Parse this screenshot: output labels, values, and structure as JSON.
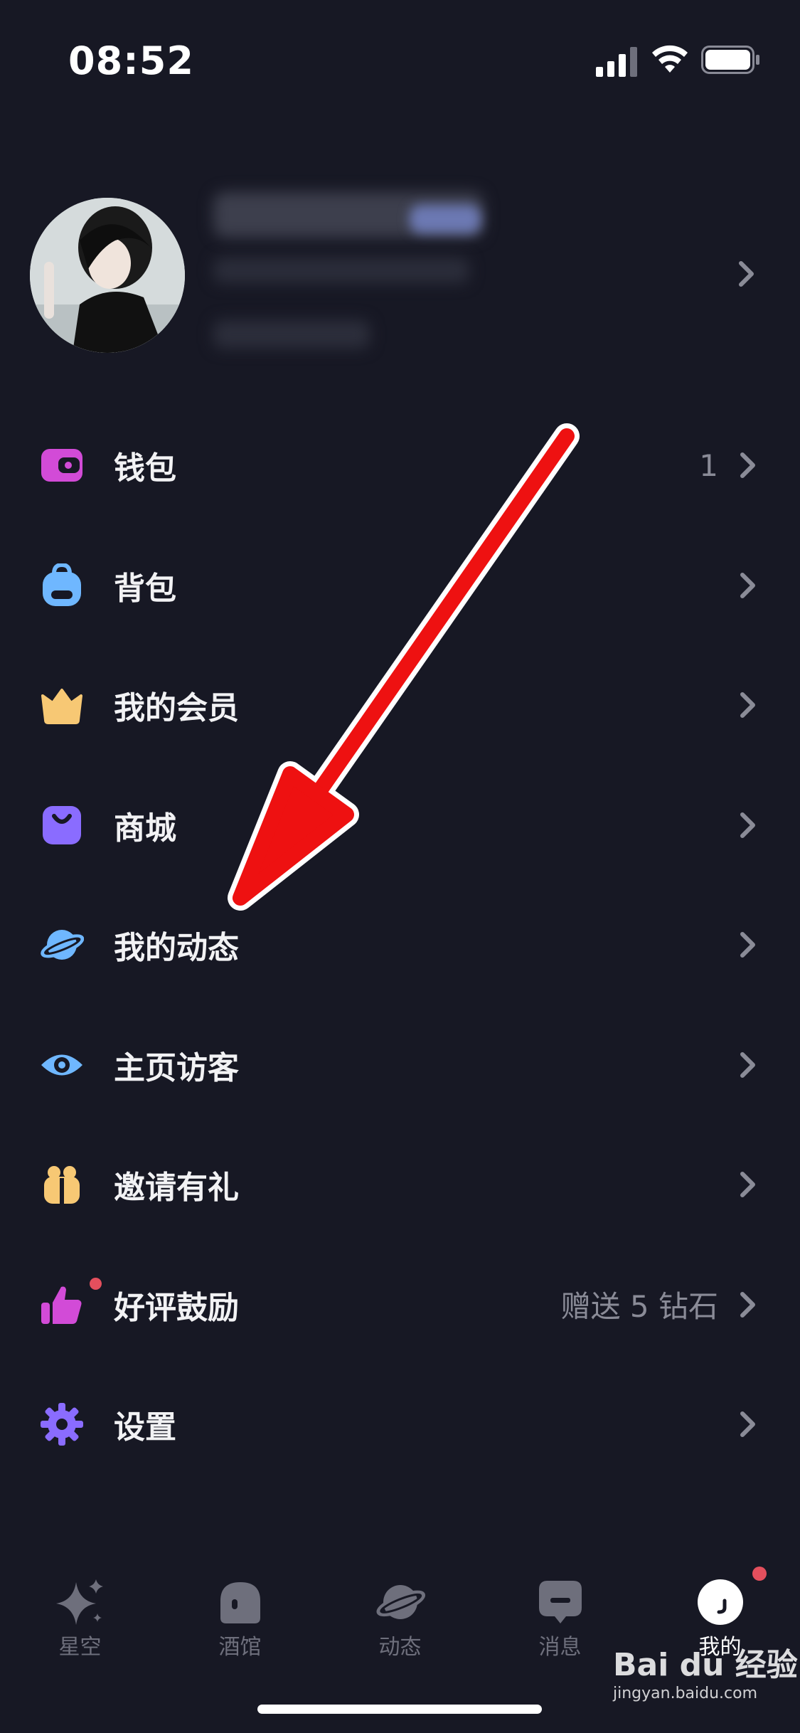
{
  "status_bar": {
    "time": "08:52"
  },
  "menu": {
    "items": [
      {
        "label": "钱包",
        "value": "1",
        "icon": "wallet-icon",
        "color": "#d24bd7"
      },
      {
        "label": "背包",
        "value": "",
        "icon": "backpack-icon",
        "color": "#6fb7ff"
      },
      {
        "label": "我的会员",
        "value": "",
        "icon": "crown-icon",
        "color": "#f7c874"
      },
      {
        "label": "商城",
        "value": "",
        "icon": "shopping-bag-icon",
        "color": "#8a6cff"
      },
      {
        "label": "我的动态",
        "value": "",
        "icon": "planet-icon",
        "color": "#6fb7ff"
      },
      {
        "label": "主页访客",
        "value": "",
        "icon": "eye-icon",
        "color": "#6fb7ff"
      },
      {
        "label": "邀请有礼",
        "value": "",
        "icon": "gift-icon",
        "color": "#f7c874"
      },
      {
        "label": "好评鼓励",
        "value": "赠送 5 钻石",
        "icon": "thumbs-up-icon",
        "color": "#d24bd7"
      },
      {
        "label": "设置",
        "value": "",
        "icon": "gear-icon",
        "color": "#8a6cff"
      }
    ]
  },
  "tabbar": {
    "tabs": [
      {
        "label": "星空",
        "icon": "sparkle-icon",
        "active": false
      },
      {
        "label": "酒馆",
        "icon": "tavern-icon",
        "active": false
      },
      {
        "label": "动态",
        "icon": "planet-icon",
        "active": false
      },
      {
        "label": "消息",
        "icon": "message-icon",
        "active": false
      },
      {
        "label": "我的",
        "icon": "profile-icon",
        "active": true
      }
    ]
  },
  "watermark": {
    "brand": "Bai du 经验",
    "url": "jingyan.baidu.com"
  },
  "colors": {
    "background": "#171824",
    "accent_red": "#e44f5d",
    "annotation_arrow": "#ee1111"
  }
}
